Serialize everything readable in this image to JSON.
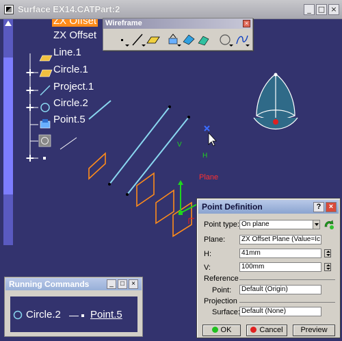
{
  "window": {
    "title": "Surface EX14.CATPart:2",
    "minimize": "_",
    "maximize": "□",
    "close": "×"
  },
  "tree": {
    "items": [
      {
        "label": "ZX Offset",
        "selected": true
      },
      {
        "label": "ZX Offset",
        "selected": false
      },
      {
        "label": "Line.1",
        "selected": false
      },
      {
        "label": "Circle.1",
        "selected": false
      },
      {
        "label": "Project.1",
        "selected": false
      },
      {
        "label": "Circle.2",
        "selected": false
      },
      {
        "label": "Point.5",
        "selected": false
      }
    ]
  },
  "toolbar": {
    "title": "Wireframe",
    "close": "×"
  },
  "viewport": {
    "plane_label": "Plane",
    "h_label": "H",
    "v_label": "V"
  },
  "dialog": {
    "title": "Point Definition",
    "help": "?",
    "close": "×",
    "point_type_label": "Point type:",
    "point_type_value": "On plane",
    "plane_label": "Plane:",
    "plane_value": "ZX Offset Plane (Value=Ic",
    "h_label": "H:",
    "h_value": "41mm",
    "v_label": "V:",
    "v_value": "100mm",
    "reference_header": "Reference",
    "ref_point_label": "Point:",
    "ref_point_value": "Default (Origin)",
    "projection_header": "Projection",
    "surface_label": "Surface:",
    "surface_value": "Default (None)",
    "ok_label": "OK",
    "cancel_label": "Cancel",
    "preview_label": "Preview"
  },
  "running_commands": {
    "title": "Running Commands",
    "item1": "Circle.2",
    "item2": "Point.5",
    "minimize": "_",
    "maximize": "□",
    "close": "×"
  },
  "colors": {
    "viewport_bg": "#33336e",
    "orange": "#ff8c1a",
    "line_cyan": "#8ad8f0",
    "dialog_close": "#d84a3a"
  }
}
